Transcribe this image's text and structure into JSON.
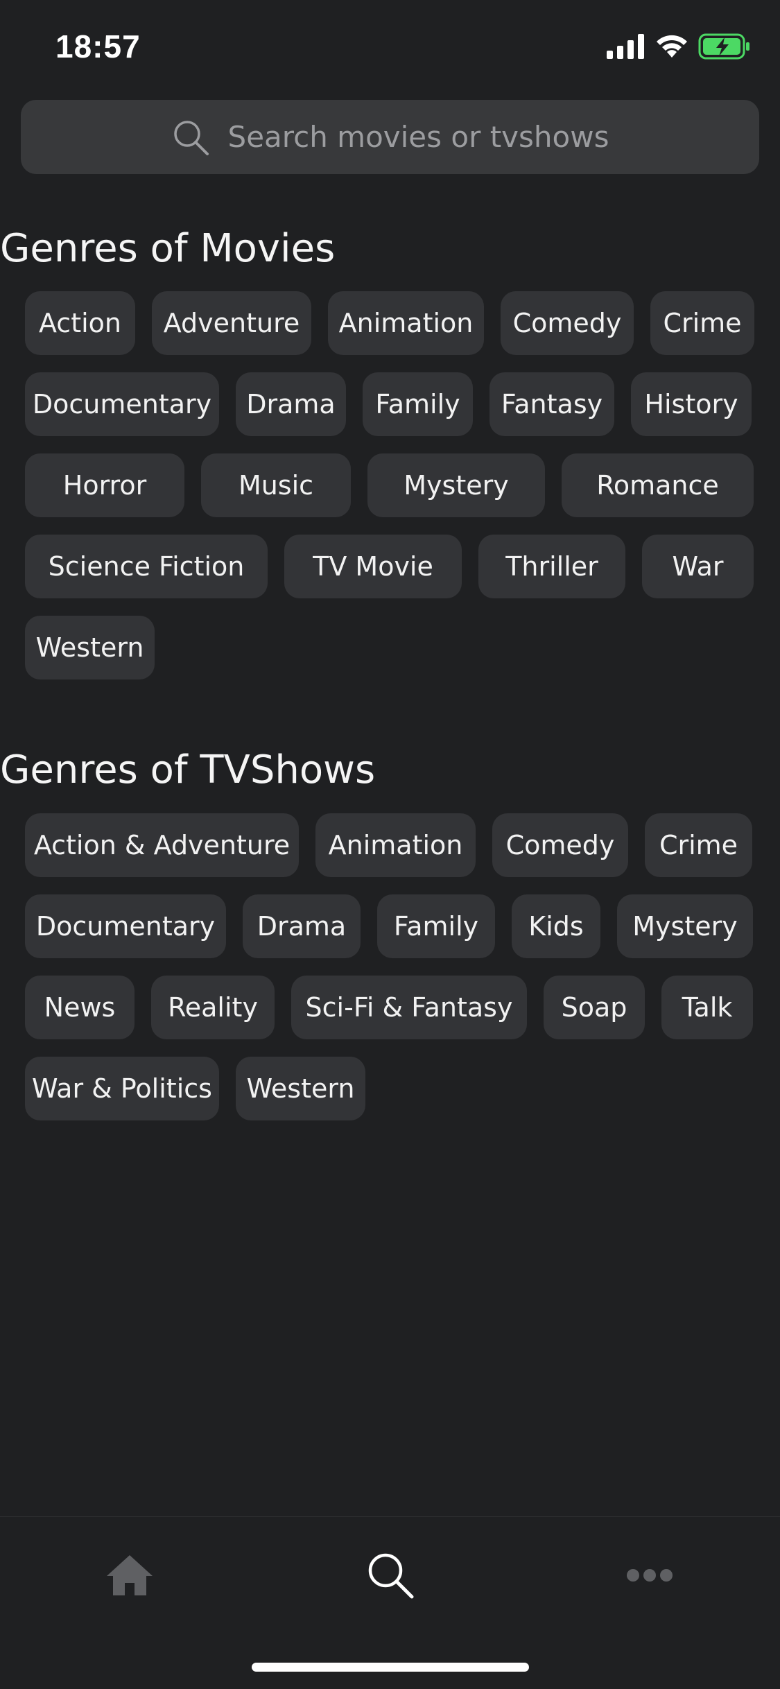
{
  "status": {
    "time": "18:57"
  },
  "search": {
    "placeholder": "Search movies or tvshows"
  },
  "movies": {
    "title": "Genres of Movies",
    "rows": [
      [
        "Action",
        "Adventure",
        "Animation",
        "Comedy",
        "Crime"
      ],
      [
        "Documentary",
        "Drama",
        "Family",
        "Fantasy",
        "History"
      ],
      [
        "Horror",
        "Music",
        "Mystery",
        "Romance"
      ],
      [
        "Science Fiction",
        "TV Movie",
        "Thriller",
        "War"
      ],
      [
        "Western"
      ]
    ]
  },
  "tvshows": {
    "title": "Genres of TVShows",
    "rows": [
      [
        "Action & Adventure",
        "Animation",
        "Comedy",
        "Crime"
      ],
      [
        "Documentary",
        "Drama",
        "Family",
        "Kids",
        "Mystery"
      ],
      [
        "News",
        "Reality",
        "Sci-Fi & Fantasy",
        "Soap",
        "Talk"
      ],
      [
        "War & Politics",
        "Western"
      ]
    ]
  },
  "tabs": [
    {
      "icon": "home-icon",
      "active": false
    },
    {
      "icon": "search-icon",
      "active": true
    },
    {
      "icon": "more-icon",
      "active": false
    }
  ],
  "colors": {
    "background": "#1f2022",
    "chip": "#333437",
    "search_bg": "#38393b",
    "battery_green": "#4cd964",
    "inactive_tab": "#5f6063"
  }
}
